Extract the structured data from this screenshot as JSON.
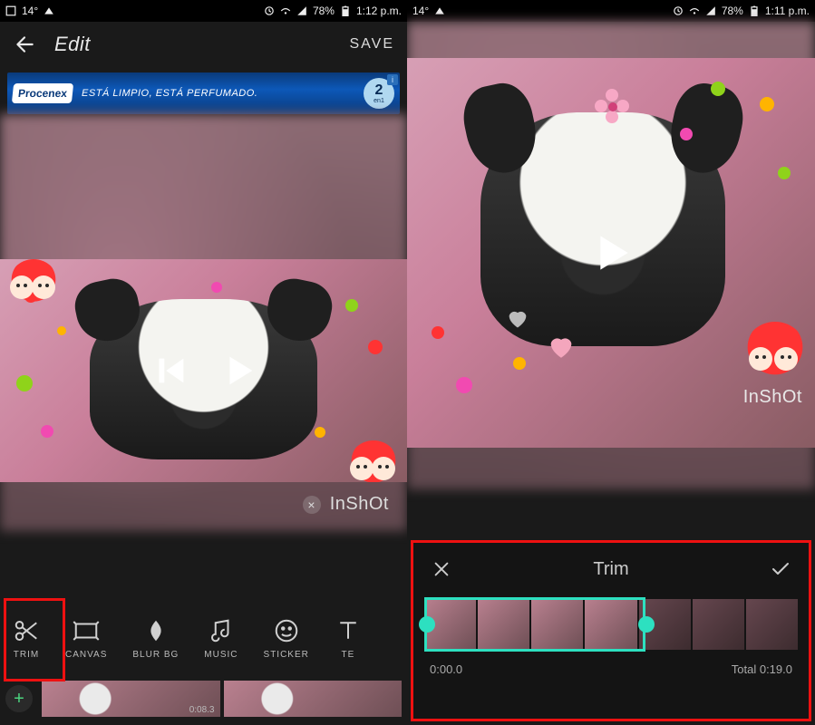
{
  "left": {
    "statusbar": {
      "temp": "14°",
      "battery": "78%",
      "time": "1:12 p.m."
    },
    "header": {
      "title": "Edit",
      "save": "SAVE"
    },
    "ad": {
      "brand": "Procenex",
      "slogan": "ESTÁ LIMPIO, ESTÁ PERFUMADO.",
      "badge_big": "2",
      "badge_small": "en1"
    },
    "watermark": "InShOt",
    "tools": [
      {
        "label": "TRIM",
        "icon": "scissors-icon"
      },
      {
        "label": "CANVAS",
        "icon": "canvas-icon"
      },
      {
        "label": "BLUR BG",
        "icon": "blur-icon"
      },
      {
        "label": "MUSIC",
        "icon": "music-icon"
      },
      {
        "label": "STICKER",
        "icon": "sticker-icon"
      },
      {
        "label": "TE",
        "icon": "text-icon"
      }
    ],
    "clip_time": "0:08.3"
  },
  "right": {
    "statusbar": {
      "temp": "14°",
      "battery": "78%",
      "time": "1:11 p.m."
    },
    "watermark": "InShOt",
    "trim_title": "Trim",
    "trim_current": "0:00.0",
    "trim_total_label": "Total",
    "trim_total": "0:19.0"
  }
}
